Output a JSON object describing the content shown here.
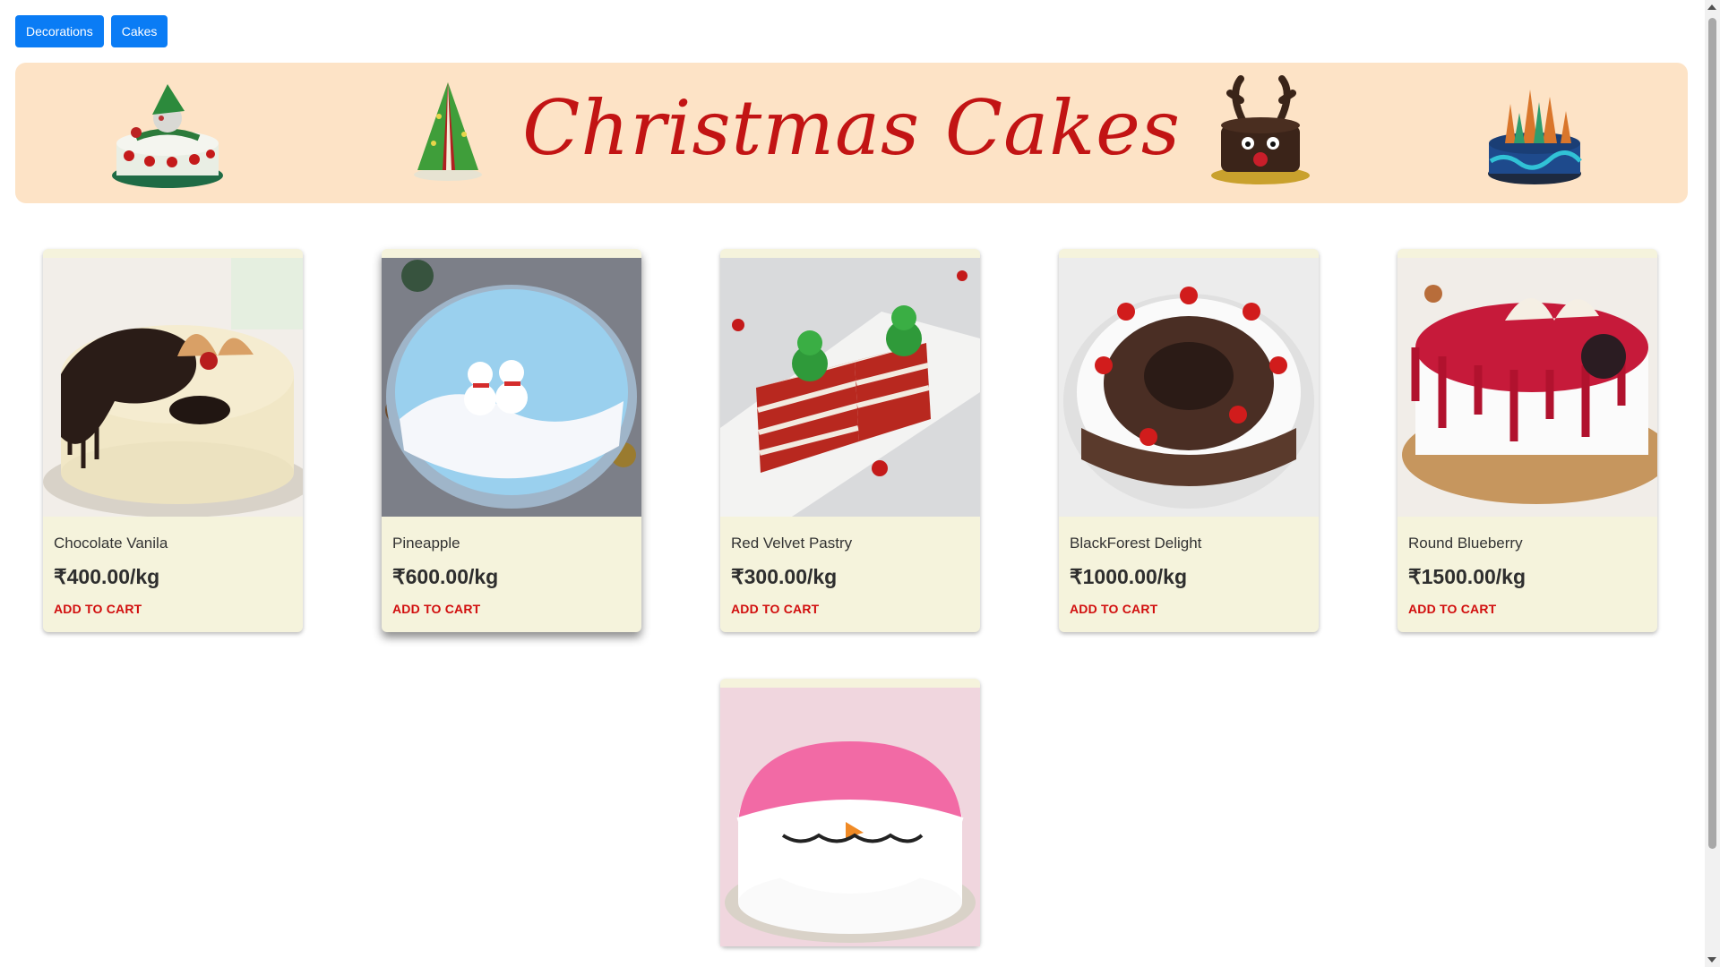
{
  "nav": {
    "buttons": [
      "Decorations",
      "Cakes"
    ]
  },
  "banner": {
    "title": "Christmas Cakes"
  },
  "colors": {
    "accent": "#0a7cf5",
    "banner_bg": "#fde3c6",
    "title": "#c21414",
    "card_bg": "#f5f3dc",
    "cart": "#d10d0d"
  },
  "products": [
    {
      "name": "Chocolate Vanila",
      "price": "₹400.00/kg",
      "cta": "ADD TO CART"
    },
    {
      "name": "Pineapple",
      "price": "₹600.00/kg",
      "cta": "ADD TO CART"
    },
    {
      "name": "Red Velvet Pastry",
      "price": "₹300.00/kg",
      "cta": "ADD TO CART"
    },
    {
      "name": "BlackForest Delight",
      "price": "₹1000.00/kg",
      "cta": "ADD TO CART"
    },
    {
      "name": "Round Blueberry",
      "price": "₹1500.00/kg",
      "cta": "ADD TO CART"
    },
    {
      "name": "",
      "price": "",
      "cta": ""
    }
  ]
}
